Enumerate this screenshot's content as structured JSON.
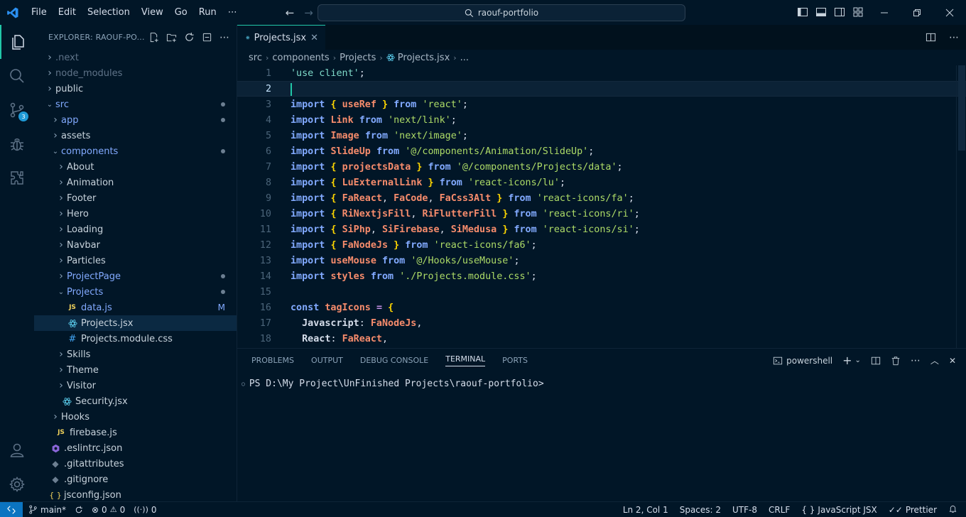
{
  "titlebar": {
    "menu": [
      "File",
      "Edit",
      "Selection",
      "View",
      "Go",
      "Run",
      "⋯"
    ],
    "search_text": "raouf-portfolio"
  },
  "activity_bar": {
    "scm_badge": "3"
  },
  "explorer": {
    "title": "EXPLORER: RAOUF-PO...",
    "items": [
      {
        "label": ".next",
        "indent": 0,
        "type": "folder",
        "dim": true
      },
      {
        "label": "node_modules",
        "indent": 0,
        "type": "folder",
        "dim": true
      },
      {
        "label": "public",
        "indent": 0,
        "type": "folder"
      },
      {
        "label": "src",
        "indent": 0,
        "type": "folder-open",
        "blue": true,
        "dot": true
      },
      {
        "label": "app",
        "indent": 1,
        "type": "folder",
        "blue": true,
        "dot": true
      },
      {
        "label": "assets",
        "indent": 1,
        "type": "folder"
      },
      {
        "label": "components",
        "indent": 1,
        "type": "folder-open",
        "blue": true,
        "dot": true
      },
      {
        "label": "About",
        "indent": 2,
        "type": "folder"
      },
      {
        "label": "Animation",
        "indent": 2,
        "type": "folder"
      },
      {
        "label": "Footer",
        "indent": 2,
        "type": "folder"
      },
      {
        "label": "Hero",
        "indent": 2,
        "type": "folder"
      },
      {
        "label": "Loading",
        "indent": 2,
        "type": "folder"
      },
      {
        "label": "Navbar",
        "indent": 2,
        "type": "folder"
      },
      {
        "label": "Particles",
        "indent": 2,
        "type": "folder"
      },
      {
        "label": "ProjectPage",
        "indent": 2,
        "type": "folder",
        "blue": true,
        "dot": true
      },
      {
        "label": "Projects",
        "indent": 2,
        "type": "folder-open",
        "blue": true,
        "dot": true
      },
      {
        "label": "data.js",
        "indent": 3,
        "type": "js",
        "blue": true,
        "mark": "M"
      },
      {
        "label": "Projects.jsx",
        "indent": 3,
        "type": "jsx",
        "selected": true
      },
      {
        "label": "Projects.module.css",
        "indent": 3,
        "type": "css"
      },
      {
        "label": "Skills",
        "indent": 2,
        "type": "folder"
      },
      {
        "label": "Theme",
        "indent": 2,
        "type": "folder"
      },
      {
        "label": "Visitor",
        "indent": 2,
        "type": "folder"
      },
      {
        "label": "Security.jsx",
        "indent": 2,
        "type": "jsx-file"
      },
      {
        "label": "Hooks",
        "indent": 1,
        "type": "folder"
      },
      {
        "label": "firebase.js",
        "indent": 1,
        "type": "js-file"
      },
      {
        "label": ".eslintrc.json",
        "indent": 0,
        "type": "eslint"
      },
      {
        "label": ".gitattributes",
        "indent": 0,
        "type": "git"
      },
      {
        "label": ".gitignore",
        "indent": 0,
        "type": "git"
      },
      {
        "label": "jsconfig.json",
        "indent": 0,
        "type": "json"
      }
    ]
  },
  "editor": {
    "tab_label": "Projects.jsx",
    "breadcrumb": [
      "src",
      "components",
      "Projects",
      "Projects.jsx",
      "..."
    ],
    "lines": [
      [
        [
          "st2",
          "'use client'"
        ],
        [
          "pn",
          ";"
        ]
      ],
      [],
      [
        [
          "kw",
          "import"
        ],
        [
          "pn",
          " "
        ],
        [
          "br",
          "{"
        ],
        [
          "pn",
          " "
        ],
        [
          "id",
          "useRef"
        ],
        [
          "pn",
          " "
        ],
        [
          "br",
          "}"
        ],
        [
          "pn",
          " "
        ],
        [
          "kw",
          "from"
        ],
        [
          "pn",
          " "
        ],
        [
          "st",
          "'react'"
        ],
        [
          "pn",
          ";"
        ]
      ],
      [
        [
          "kw",
          "import"
        ],
        [
          "pn",
          " "
        ],
        [
          "id",
          "Link"
        ],
        [
          "pn",
          " "
        ],
        [
          "kw",
          "from"
        ],
        [
          "pn",
          " "
        ],
        [
          "st",
          "'next/link'"
        ],
        [
          "pn",
          ";"
        ]
      ],
      [
        [
          "kw",
          "import"
        ],
        [
          "pn",
          " "
        ],
        [
          "id",
          "Image"
        ],
        [
          "pn",
          " "
        ],
        [
          "kw",
          "from"
        ],
        [
          "pn",
          " "
        ],
        [
          "st",
          "'next/image'"
        ],
        [
          "pn",
          ";"
        ]
      ],
      [
        [
          "kw",
          "import"
        ],
        [
          "pn",
          " "
        ],
        [
          "id",
          "SlideUp"
        ],
        [
          "pn",
          " "
        ],
        [
          "kw",
          "from"
        ],
        [
          "pn",
          " "
        ],
        [
          "st",
          "'@/components/Animation/SlideUp'"
        ],
        [
          "pn",
          ";"
        ]
      ],
      [
        [
          "kw",
          "import"
        ],
        [
          "pn",
          " "
        ],
        [
          "br",
          "{"
        ],
        [
          "pn",
          " "
        ],
        [
          "id",
          "projectsData"
        ],
        [
          "pn",
          " "
        ],
        [
          "br",
          "}"
        ],
        [
          "pn",
          " "
        ],
        [
          "kw",
          "from"
        ],
        [
          "pn",
          " "
        ],
        [
          "st",
          "'@/components/Projects/data'"
        ],
        [
          "pn",
          ";"
        ]
      ],
      [
        [
          "kw",
          "import"
        ],
        [
          "pn",
          " "
        ],
        [
          "br",
          "{"
        ],
        [
          "pn",
          " "
        ],
        [
          "id",
          "LuExternalLink"
        ],
        [
          "pn",
          " "
        ],
        [
          "br",
          "}"
        ],
        [
          "pn",
          " "
        ],
        [
          "kw",
          "from"
        ],
        [
          "pn",
          " "
        ],
        [
          "st",
          "'react-icons/lu'"
        ],
        [
          "pn",
          ";"
        ]
      ],
      [
        [
          "kw",
          "import"
        ],
        [
          "pn",
          " "
        ],
        [
          "br",
          "{"
        ],
        [
          "pn",
          " "
        ],
        [
          "id",
          "FaReact"
        ],
        [
          "pn",
          ", "
        ],
        [
          "id",
          "FaCode"
        ],
        [
          "pn",
          ", "
        ],
        [
          "id",
          "FaCss3Alt"
        ],
        [
          "pn",
          " "
        ],
        [
          "br",
          "}"
        ],
        [
          "pn",
          " "
        ],
        [
          "kw",
          "from"
        ],
        [
          "pn",
          " "
        ],
        [
          "st",
          "'react-icons/fa'"
        ],
        [
          "pn",
          ";"
        ]
      ],
      [
        [
          "kw",
          "import"
        ],
        [
          "pn",
          " "
        ],
        [
          "br",
          "{"
        ],
        [
          "pn",
          " "
        ],
        [
          "id",
          "RiNextjsFill"
        ],
        [
          "pn",
          ", "
        ],
        [
          "id",
          "RiFlutterFill"
        ],
        [
          "pn",
          " "
        ],
        [
          "br",
          "}"
        ],
        [
          "pn",
          " "
        ],
        [
          "kw",
          "from"
        ],
        [
          "pn",
          " "
        ],
        [
          "st",
          "'react-icons/ri'"
        ],
        [
          "pn",
          ";"
        ]
      ],
      [
        [
          "kw",
          "import"
        ],
        [
          "pn",
          " "
        ],
        [
          "br",
          "{"
        ],
        [
          "pn",
          " "
        ],
        [
          "id",
          "SiPhp"
        ],
        [
          "pn",
          ", "
        ],
        [
          "id",
          "SiFirebase"
        ],
        [
          "pn",
          ", "
        ],
        [
          "id",
          "SiMedusa"
        ],
        [
          "pn",
          " "
        ],
        [
          "br",
          "}"
        ],
        [
          "pn",
          " "
        ],
        [
          "kw",
          "from"
        ],
        [
          "pn",
          " "
        ],
        [
          "st",
          "'react-icons/si'"
        ],
        [
          "pn",
          ";"
        ]
      ],
      [
        [
          "kw",
          "import"
        ],
        [
          "pn",
          " "
        ],
        [
          "br",
          "{"
        ],
        [
          "pn",
          " "
        ],
        [
          "id",
          "FaNodeJs"
        ],
        [
          "pn",
          " "
        ],
        [
          "br",
          "}"
        ],
        [
          "pn",
          " "
        ],
        [
          "kw",
          "from"
        ],
        [
          "pn",
          " "
        ],
        [
          "st",
          "'react-icons/fa6'"
        ],
        [
          "pn",
          ";"
        ]
      ],
      [
        [
          "kw",
          "import"
        ],
        [
          "pn",
          " "
        ],
        [
          "id",
          "useMouse"
        ],
        [
          "pn",
          " "
        ],
        [
          "kw",
          "from"
        ],
        [
          "pn",
          " "
        ],
        [
          "st",
          "'@/Hooks/useMouse'"
        ],
        [
          "pn",
          ";"
        ]
      ],
      [
        [
          "kw",
          "import"
        ],
        [
          "pn",
          " "
        ],
        [
          "id",
          "styles"
        ],
        [
          "pn",
          " "
        ],
        [
          "kw",
          "from"
        ],
        [
          "pn",
          " "
        ],
        [
          "st",
          "'./Projects.module.css'"
        ],
        [
          "pn",
          ";"
        ]
      ],
      [],
      [
        [
          "kw",
          "const"
        ],
        [
          "pn",
          " "
        ],
        [
          "vr",
          "tagIcons"
        ],
        [
          "pn",
          " "
        ],
        [
          "op",
          "="
        ],
        [
          "pn",
          " "
        ],
        [
          "br",
          "{"
        ]
      ],
      [
        [
          "pn",
          "  "
        ],
        [
          "pr",
          "Javascript"
        ],
        [
          "pn",
          ": "
        ],
        [
          "id",
          "FaNodeJs"
        ],
        [
          "pn",
          ","
        ]
      ],
      [
        [
          "pn",
          "  "
        ],
        [
          "pr",
          "React"
        ],
        [
          "pn",
          ": "
        ],
        [
          "id",
          "FaReact"
        ],
        [
          "pn",
          ","
        ]
      ]
    ],
    "line_numbers": [
      "1",
      "2",
      "3",
      "4",
      "5",
      "6",
      "7",
      "8",
      "9",
      "10",
      "11",
      "12",
      "13",
      "14",
      "15",
      "16",
      "17",
      "18"
    ]
  },
  "panel": {
    "tabs": [
      "PROBLEMS",
      "OUTPUT",
      "DEBUG CONSOLE",
      "TERMINAL",
      "PORTS"
    ],
    "active_tab": "TERMINAL",
    "shell": "powershell",
    "prompt": "PS D:\\My Project\\UnFinished Projects\\raouf-portfolio>"
  },
  "statusbar": {
    "branch": "main*",
    "errors": "0",
    "warnings": "0",
    "ports": "0",
    "position": "Ln 2, Col 1",
    "spaces": "Spaces: 2",
    "encoding": "UTF-8",
    "eol": "CRLF",
    "language": "JavaScript JSX",
    "formatter": "Prettier"
  }
}
